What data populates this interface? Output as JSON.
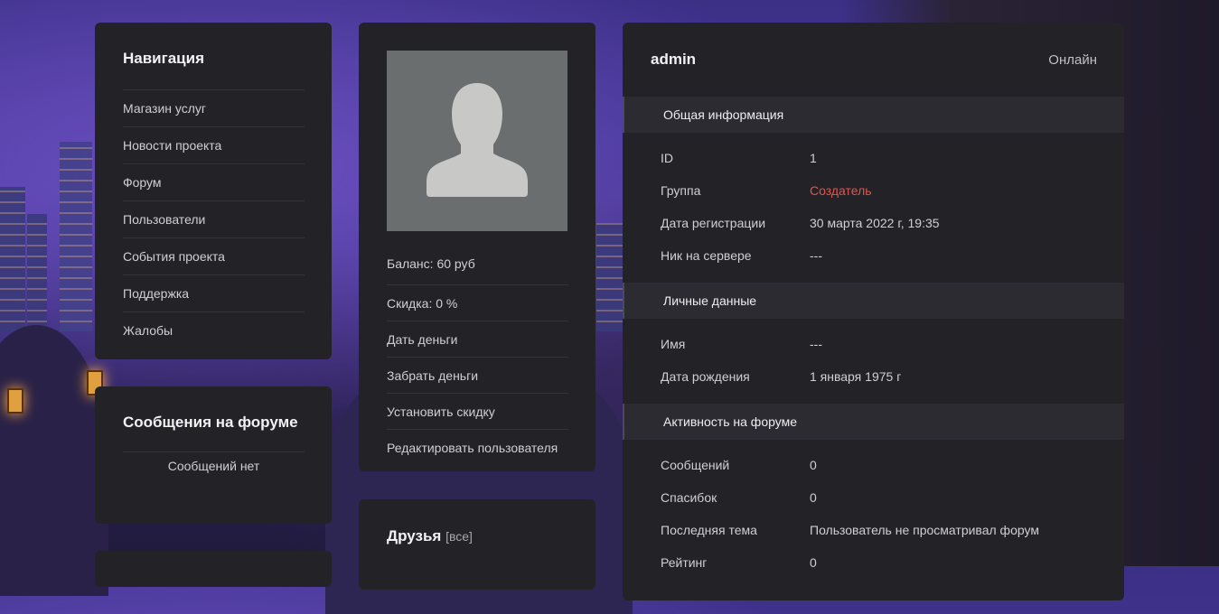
{
  "colors": {
    "card_bg": "#232226",
    "section_bg": "#2c2b31",
    "accent_red": "#e2554f",
    "avatar_bg": "#6b6e6e"
  },
  "navigation": {
    "title": "Навигация",
    "items": [
      {
        "label": "Магазин услуг",
        "icon": ""
      },
      {
        "label": "Новости проекта"
      },
      {
        "label": "Форум"
      },
      {
        "label": "Пользователи"
      },
      {
        "label": "События проекта"
      },
      {
        "label": "Поддержка"
      },
      {
        "label": "Жалобы"
      }
    ]
  },
  "forum_messages": {
    "title": "Сообщения на форуме",
    "empty_text": "Сообщений нет"
  },
  "profile": {
    "avatar_icon": "user-silhouette-icon",
    "balance": "Баланс: 60 руб",
    "discount": "Скидка: 0 %",
    "actions": [
      "Дать деньги",
      "Забрать деньги",
      "Установить скидку",
      "Редактировать пользователя"
    ]
  },
  "friends": {
    "title": "Друзья",
    "all_link": "[все]"
  },
  "user": {
    "name": "admin",
    "status": "Онлайн",
    "sections": [
      {
        "title": "Общая информация",
        "rows": [
          {
            "key": "ID",
            "value": "1"
          },
          {
            "key": "Группа",
            "value": "Создатель"
          },
          {
            "key": "Дата регистрации",
            "value": "30 марта 2022 г, 19:35"
          },
          {
            "key": "Ник на сервере",
            "value": "---"
          }
        ]
      },
      {
        "title": "Личные данные",
        "rows": [
          {
            "key": "Имя",
            "value": "---"
          },
          {
            "key": "Дата рождения",
            "value": "1 января 1975 г"
          }
        ]
      },
      {
        "title": "Активность на форуме",
        "rows": [
          {
            "key": "Сообщений",
            "value": "0"
          },
          {
            "key": "Спасибок",
            "value": "0"
          },
          {
            "key": "Последняя тема",
            "value": "Пользователь не просматривал форум"
          },
          {
            "key": "Рейтинг",
            "value": "0"
          }
        ]
      }
    ]
  }
}
